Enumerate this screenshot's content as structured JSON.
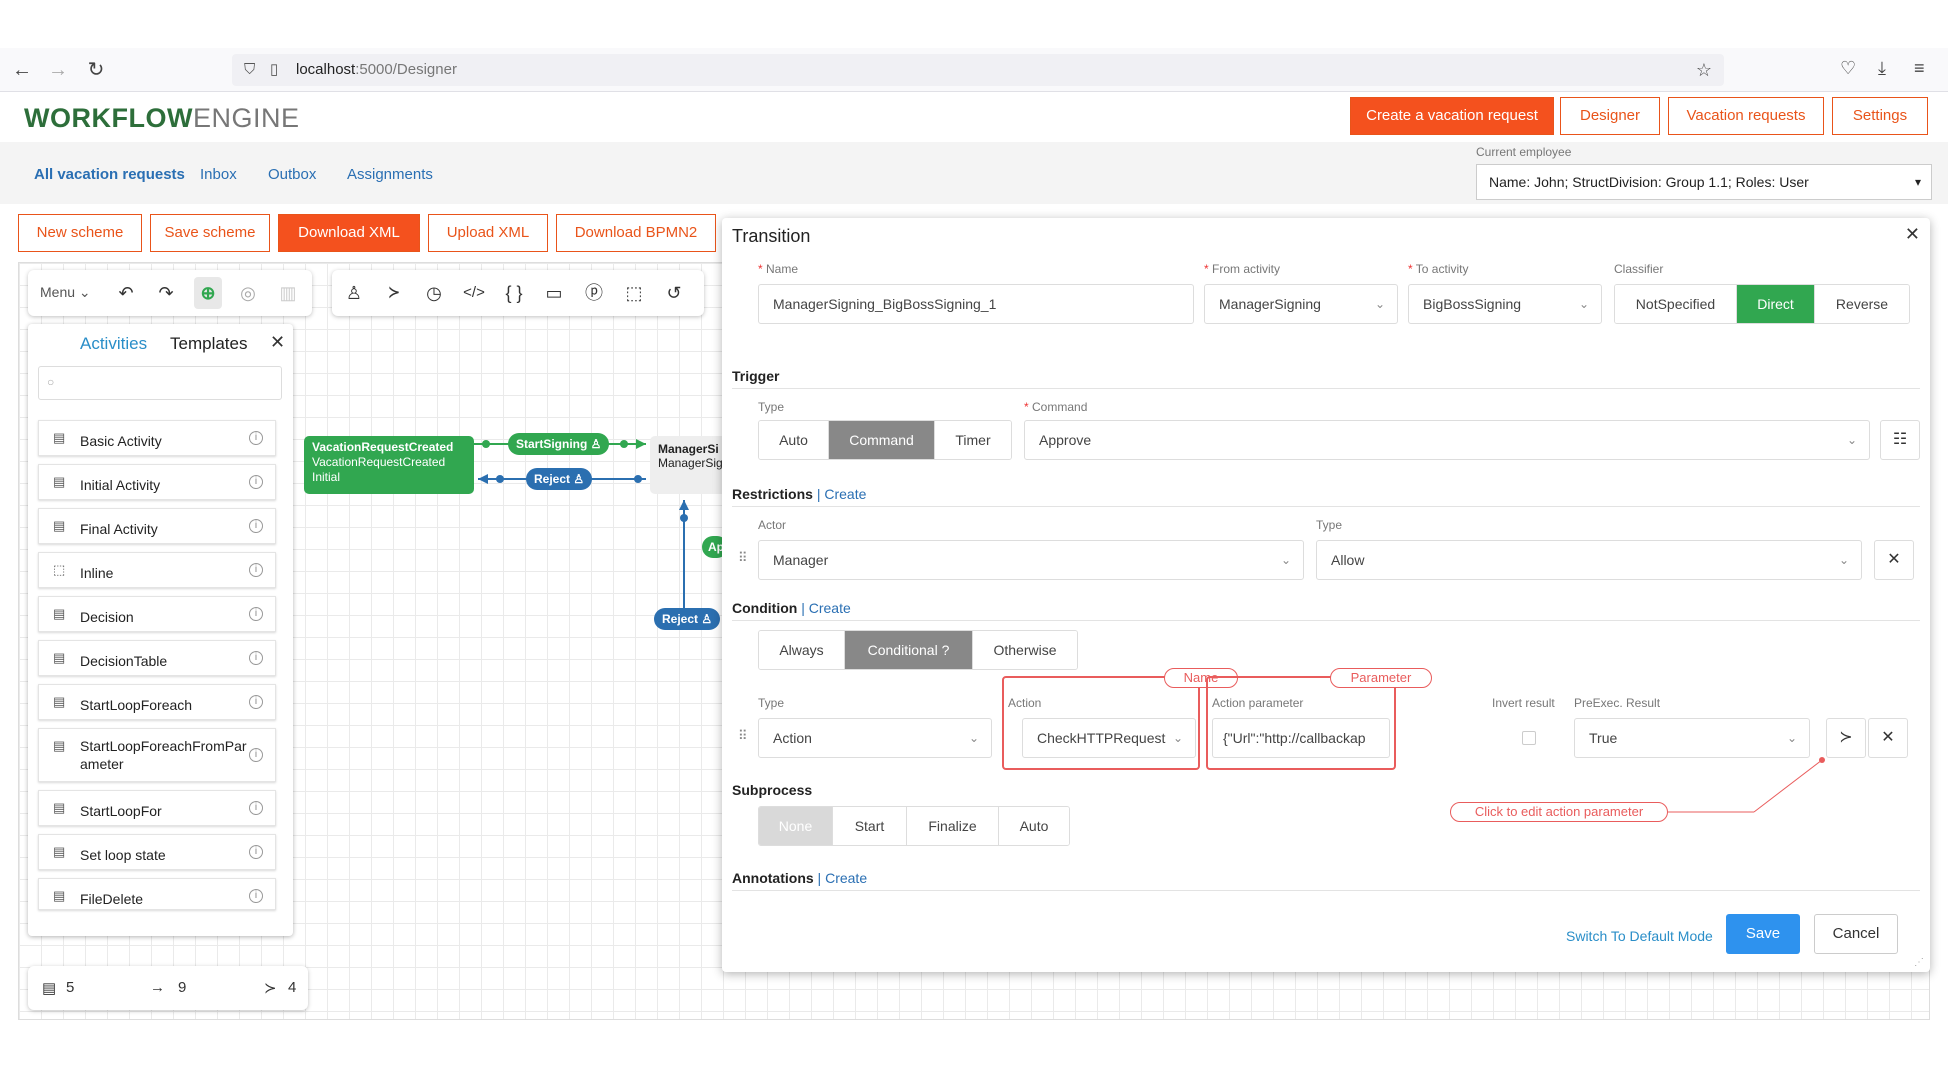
{
  "browser": {
    "url_host": "localhost",
    "url_path": ":5000/Designer"
  },
  "header": {
    "logo_workflow": "WORKFLOW",
    "logo_engine": "ENGINE",
    "buttons": [
      "Create a vacation request",
      "Designer",
      "Vacation requests",
      "Settings"
    ]
  },
  "subnav": {
    "links": [
      "All vacation requests",
      "Inbox",
      "Outbox",
      "Assignments"
    ],
    "employee_label": "Current employee",
    "employee_value": "Name: John; StructDivision: Group 1.1; Roles: User"
  },
  "toolbar": {
    "buttons": [
      "New scheme",
      "Save scheme",
      "Download XML",
      "Upload XML",
      "Download BPMN2"
    ],
    "menu_label": "Menu"
  },
  "activities_panel": {
    "tab_activities": "Activities",
    "tab_templates": "Templates",
    "items": [
      "Basic Activity",
      "Initial Activity",
      "Final Activity",
      "Inline",
      "Decision",
      "DecisionTable",
      "StartLoopForeach",
      "StartLoopForeachFromParameter",
      "StartLoopFor",
      "Set loop state",
      "FileDelete"
    ]
  },
  "stats": {
    "activities": "5",
    "transitions": "9",
    "commands": "4"
  },
  "diagram": {
    "initial_node": {
      "line1": "VacationRequestCreated",
      "line2": "VacationRequestCreated",
      "line3": "Initial"
    },
    "manager_node": {
      "line1": "ManagerSi",
      "line2": "ManagerSig"
    },
    "pill_start": "StartSigning",
    "pill_reject1": "Reject",
    "pill_reject2": "Reject",
    "pill_approve": "Ap"
  },
  "dialog": {
    "title": "Transition",
    "name_label": "Name",
    "name_value": "ManagerSigning_BigBossSigning_1",
    "from_label": "From activity",
    "from_value": "ManagerSigning",
    "to_label": "To activity",
    "to_value": "BigBossSigning",
    "classifier_label": "Classifier",
    "classifier_options": [
      "NotSpecified",
      "Direct",
      "Reverse"
    ],
    "trigger_title": "Trigger",
    "trigger_type_label": "Type",
    "trigger_type_options": [
      "Auto",
      "Command",
      "Timer"
    ],
    "command_label": "Command",
    "command_value": "Approve",
    "restrictions_title": "Restrictions",
    "create_link": "Create",
    "actor_label": "Actor",
    "actor_value": "Manager",
    "restr_type_label": "Type",
    "restr_type_value": "Allow",
    "condition_title": "Condition",
    "condition_options": [
      "Always",
      "Conditional ?",
      "Otherwise"
    ],
    "cond_type_label": "Type",
    "cond_type_value": "Action",
    "action_label": "Action",
    "action_value": "CheckHTTPRequest",
    "action_param_label": "Action parameter",
    "action_param_value": "{\"Url\":\"http://callbackap",
    "invert_label": "Invert result",
    "preexec_label": "PreExec. Result",
    "preexec_value": "True",
    "tag_name": "Name",
    "tag_parameter": "Parameter",
    "tag_click": "Click to edit action parameter",
    "subprocess_title": "Subprocess",
    "subprocess_options": [
      "None",
      "Start",
      "Finalize",
      "Auto"
    ],
    "annotations_title": "Annotations",
    "switch_mode": "Switch To Default Mode",
    "save": "Save",
    "cancel": "Cancel"
  }
}
